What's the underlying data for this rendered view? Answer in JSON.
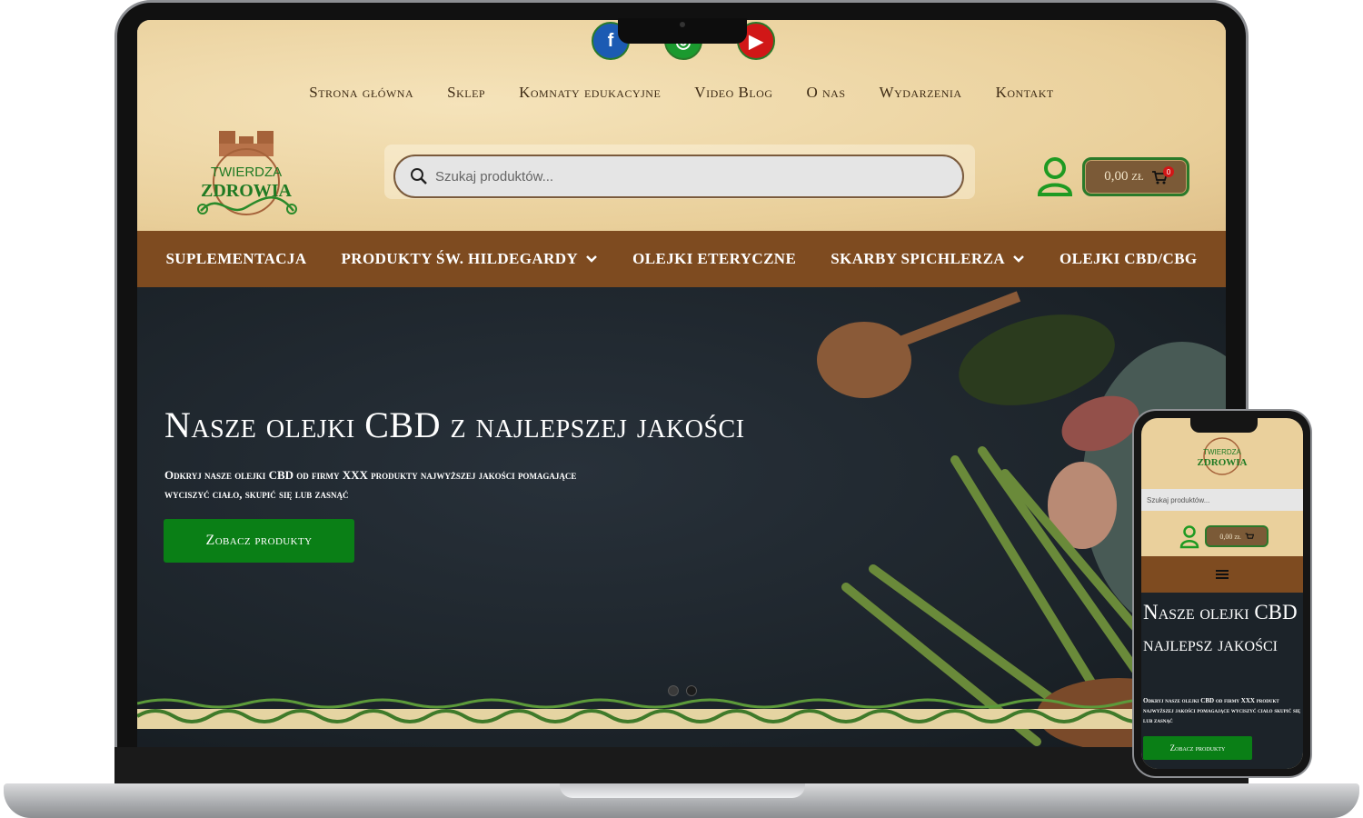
{
  "social": {
    "facebook": "f",
    "instagram": "◎",
    "youtube": "▶"
  },
  "top_nav": [
    "Strona główna",
    "Sklep",
    "Komnaty edukacyjne",
    "Video Blog",
    "O nas",
    "Wydarzenia",
    "Kontakt"
  ],
  "logo": {
    "line1": "TWIERDZA",
    "line2": "ZDROWIA"
  },
  "search": {
    "placeholder": "Szukaj produktów..."
  },
  "cart": {
    "amount": "0,00 zł",
    "count": "0"
  },
  "category_menu": [
    {
      "label": "SUPLEMENTACJA",
      "dropdown": false
    },
    {
      "label": "PRODUKTY ŚW. HILDEGARDY",
      "dropdown": true
    },
    {
      "label": "OLEJKI ETERYCZNE",
      "dropdown": false
    },
    {
      "label": "SKARBY SPICHLERZA",
      "dropdown": true
    },
    {
      "label": "OLEJKI CBD/CBG",
      "dropdown": false
    }
  ],
  "hero": {
    "title": "Nasze olejki CBD z najlepszej jakości",
    "description": "Odkryj nasze olejki CBD od firmy XXX produkty najwyższej jakości pomagające wyciszyć ciało, skupić się lub zasnąć",
    "cta": "Zobacz produkty",
    "slides_total": 2,
    "slide_active": 2
  },
  "mobile": {
    "search_placeholder": "Szukaj produktów...",
    "cart_amount": "0,00 zł",
    "hero_title": "Nasze olejki CBD z najlepsz jakości",
    "hero_description": "Odkryj nasze olejki CBD od firmy XXX produkt najwyższej jakości pomagające wyciszyć ciało skupić się lub zasnąć",
    "cta": "Zobacz produkty"
  },
  "colors": {
    "brown_menu": "#7e4b20",
    "green_accent": "#0a7f16",
    "parchment": "#ead09c",
    "hero_bg": "#1b2228"
  }
}
